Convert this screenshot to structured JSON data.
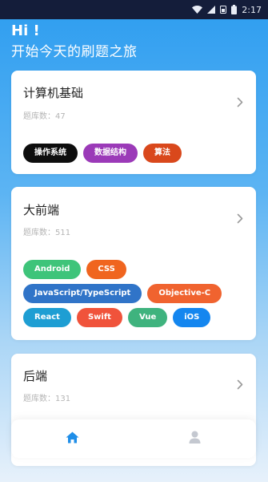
{
  "status_bar": {
    "time": "2:17",
    "icons": [
      "wifi-icon",
      "signal-icon",
      "sim-icon",
      "battery-icon"
    ]
  },
  "header": {
    "greeting": "Hi !",
    "subtitle": "开始今天的刷题之旅"
  },
  "categories": [
    {
      "title": "计算机基础",
      "count": "题库数：47",
      "tags": [
        {
          "label": "操作系统",
          "color": "#0d0d0d"
        },
        {
          "label": "数据结构",
          "color": "#9b3ab8"
        },
        {
          "label": "算法",
          "color": "#d9481c"
        }
      ]
    },
    {
      "title": "大前端",
      "count": "题库数：511",
      "tags": [
        {
          "label": "Android",
          "color": "#3ec47a"
        },
        {
          "label": "CSS",
          "color": "#f0651f"
        },
        {
          "label": "JavaScript/TypeScript",
          "color": "#3074c8"
        },
        {
          "label": "Objective-C",
          "color": "#f0632f"
        },
        {
          "label": "React",
          "color": "#1e9ed3"
        },
        {
          "label": "Swift",
          "color": "#f0533b"
        },
        {
          "label": "Vue",
          "color": "#3fb37e"
        },
        {
          "label": "iOS",
          "color": "#1486ef"
        }
      ]
    },
    {
      "title": "后端",
      "count": "题库数：131",
      "tags": []
    }
  ],
  "tabbar": {
    "items": [
      {
        "name": "home-icon",
        "active": true,
        "color": "#1f8ee8"
      },
      {
        "name": "user-icon",
        "active": false,
        "color": "#c4c8d0"
      }
    ]
  }
}
